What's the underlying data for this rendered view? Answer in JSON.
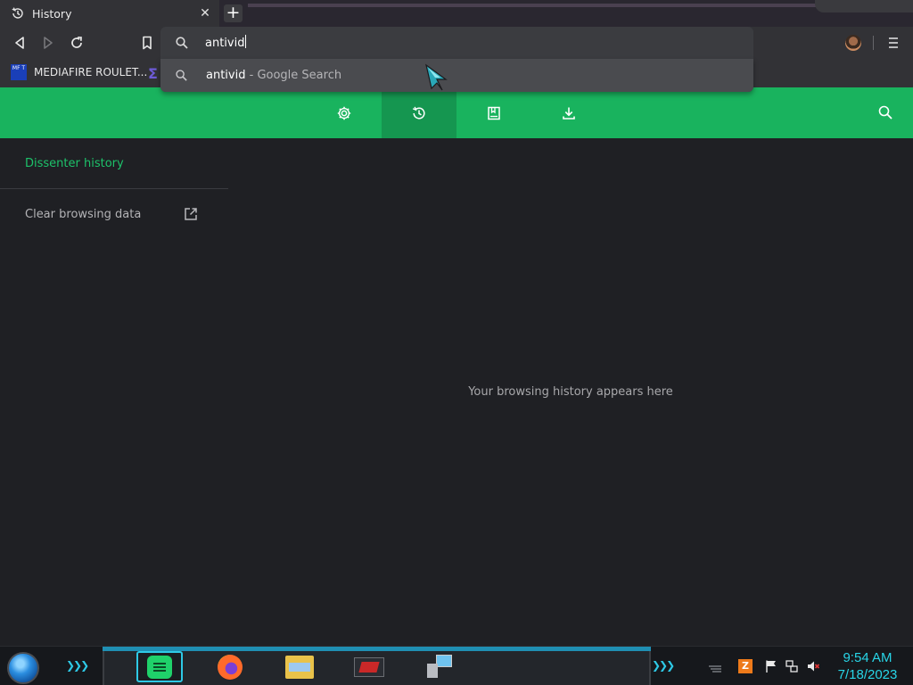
{
  "browser": {
    "tab": {
      "title": "History",
      "icon": "history-icon"
    },
    "omnibox": {
      "query": "antivid"
    },
    "suggestion": {
      "text": "antivid",
      "suffix": " - Google Search"
    },
    "bookmarks": [
      {
        "label": "MEDIAFIRE ROULET...",
        "favicon_text": "MF T",
        "favicon_color": "#1a3fb8"
      }
    ]
  },
  "page": {
    "nav": [
      {
        "name": "settings",
        "icon": "gear-icon",
        "active": false
      },
      {
        "name": "history",
        "icon": "history-icon",
        "active": true
      },
      {
        "name": "bookmarks",
        "icon": "bookmark-icon",
        "active": false
      },
      {
        "name": "downloads",
        "icon": "download-icon",
        "active": false
      }
    ],
    "sidebar": {
      "heading": "Dissenter history",
      "clear_label": "Clear browsing data"
    },
    "empty_message": "Your browsing history appears here"
  },
  "taskbar": {
    "clock": {
      "time": "9:54 AM",
      "date": "7/18/2023"
    }
  },
  "colors": {
    "accent_green": "#19b35e",
    "accent_green_dark": "#159650",
    "heading_green": "#1dc26a",
    "page_bg": "#1f2024",
    "clock_cyan": "#28d6e8"
  }
}
